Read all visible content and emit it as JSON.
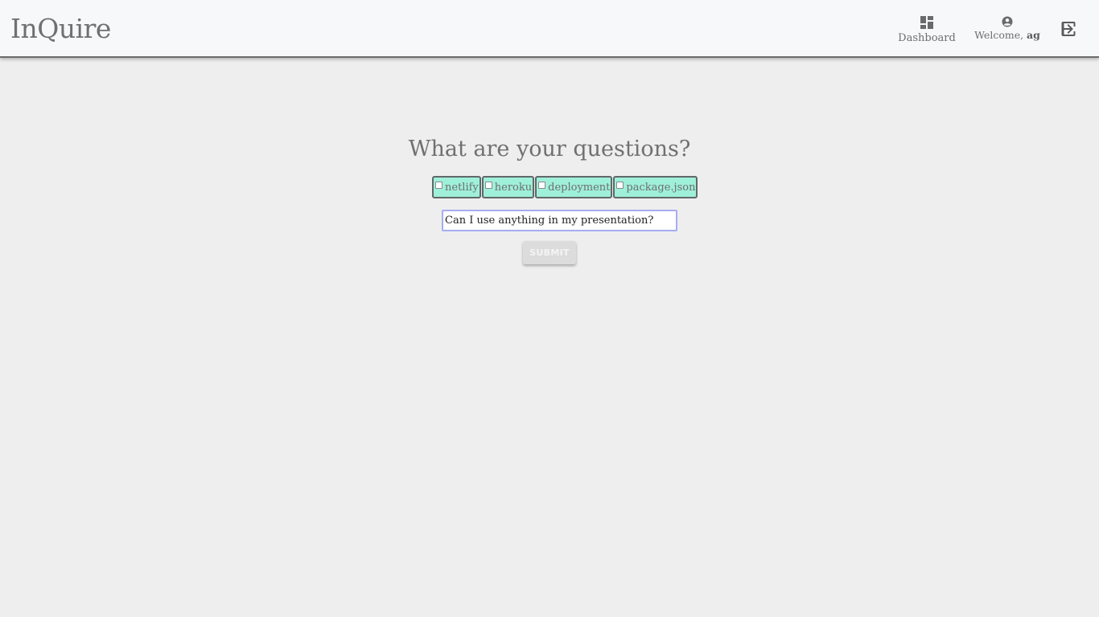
{
  "header": {
    "logo": "InQuire",
    "nav": {
      "dashboard_label": "Dashboard",
      "dashboard_icon": "dashboard-icon",
      "welcome_prefix": "Welcome, ",
      "username": "ag",
      "user_icon": "account-circle-icon",
      "logout_icon": "exit-to-app-icon"
    }
  },
  "main": {
    "title": "What are your questions?",
    "tags": [
      {
        "label": "netlify",
        "checked": false
      },
      {
        "label": "heroku",
        "checked": false
      },
      {
        "label": "deployment",
        "checked": false
      },
      {
        "label": "package.json",
        "checked": false
      }
    ],
    "question_value": "Can I use anything in my presentation?",
    "submit_label": "SUBMIT"
  },
  "colors": {
    "tag_background": "#9ff0d8",
    "input_border": "#a6acf2",
    "page_background": "#eeeeee"
  }
}
